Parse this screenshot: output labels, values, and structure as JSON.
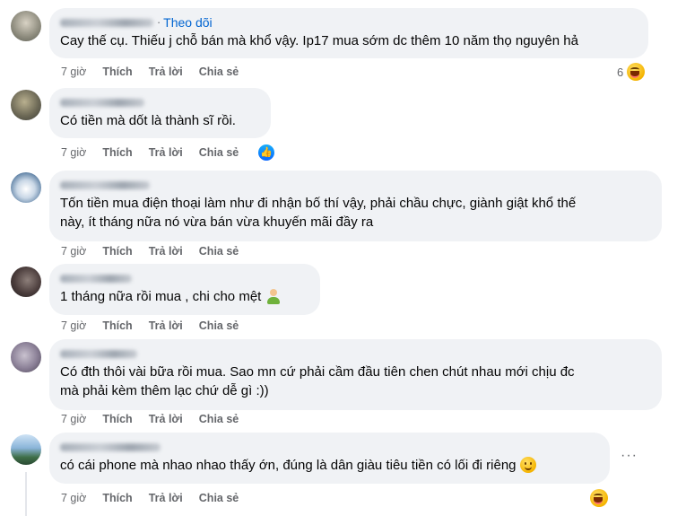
{
  "comments": [
    {
      "author_label": "Theo dõi",
      "text": "Cay thế cụ. Thiếu j chỗ bán mà khổ vậy. Ip17 mua sớm dc thêm 10 năm thọ nguyên hả",
      "time": "7 giờ",
      "like": "Thích",
      "reply": "Trả lời",
      "share": "Chia sẻ",
      "reaction_count": "6",
      "reaction_icon": "laugh-emoji"
    },
    {
      "text": "Có tiền mà dốt là thành sĩ rồi.",
      "time": "7 giờ",
      "like": "Thích",
      "reply": "Trả lời",
      "share": "Chia sẻ",
      "reaction_icon": "like-icon"
    },
    {
      "text": "Tốn tiền mua điện thoại làm như đi nhận bố thí vậy, phải chầu chực, giành giật khổ thế\nnày, ít tháng nữa nó vừa bán vừa khuyến mãi đầy ra",
      "time": "7 giờ",
      "like": "Thích",
      "reply": "Trả lời",
      "share": "Chia sẻ"
    },
    {
      "text": "1 tháng nữa rồi mua , chi cho mệt ",
      "text_emoji": "person-emoji",
      "time": "7 giờ",
      "like": "Thích",
      "reply": "Trả lời",
      "share": "Chia sẻ"
    },
    {
      "text": "Có đth thôi vài bữa rồi mua. Sao mn cứ phải cầm đầu tiên chen chút nhau mới chịu đc\nmà phải kèm thêm lạc chứ dễ gì :))",
      "time": "7 giờ",
      "like": "Thích",
      "reply": "Trả lời",
      "share": "Chia sẻ"
    },
    {
      "text": "có cái phone mà nhao nhao thấy ớn, đúng là dân giàu tiêu tiền có lối đi riêng ",
      "text_emoji": "smile-emoji",
      "time": "7 giờ",
      "like": "Thích",
      "reply": "Trả lời",
      "share": "Chia sẻ",
      "reaction_icon": "laugh-emoji",
      "more_label": "···"
    }
  ]
}
